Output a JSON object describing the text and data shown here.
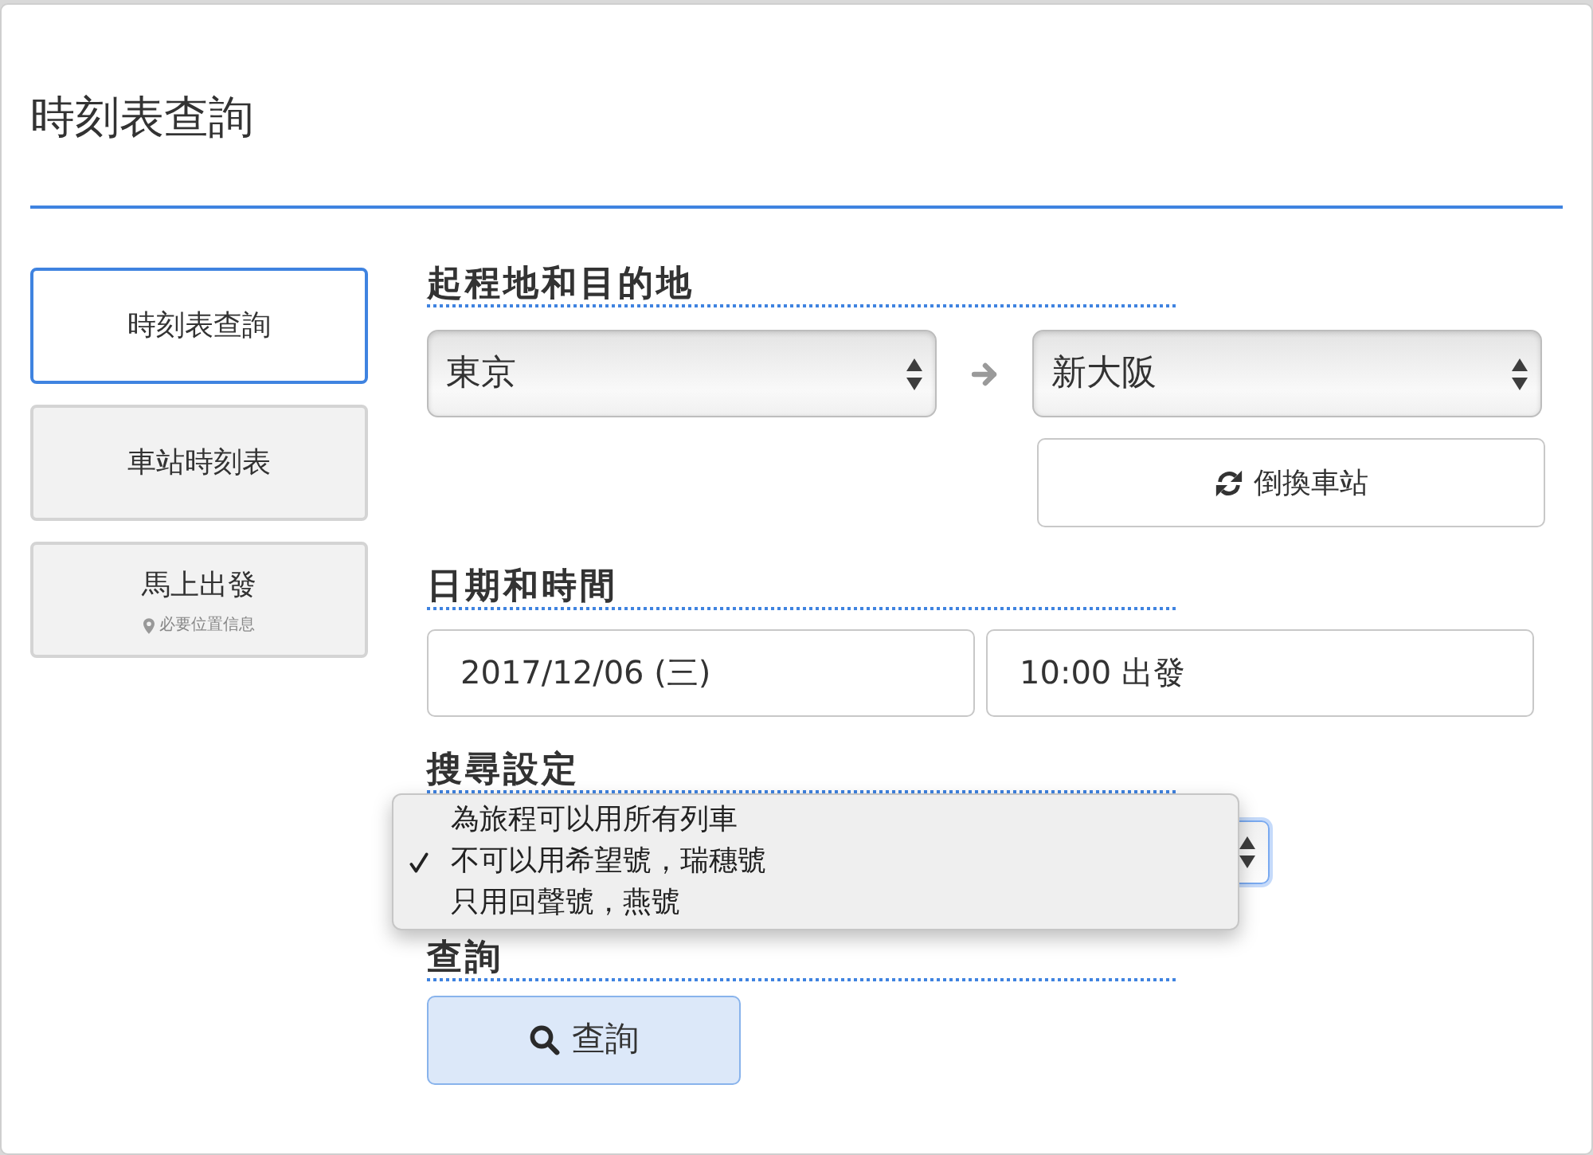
{
  "page_title": "時刻表查詢",
  "sidebar": {
    "items": [
      {
        "label": "時刻表查詢",
        "selected": true
      },
      {
        "label": "車站時刻表",
        "selected": false
      },
      {
        "label": "馬上出發",
        "selected": false,
        "note": "必要位置信息"
      }
    ]
  },
  "route": {
    "heading": "起程地和目的地",
    "from": "東京",
    "to": "新大阪",
    "swap_button": "倒換車站"
  },
  "date_time": {
    "heading": "日期和時間",
    "date": "2017/12/06 (三)",
    "time": "10:00 出發"
  },
  "search_settings": {
    "heading": "搜尋設定",
    "dropdown_open": true,
    "options": [
      {
        "label": "為旅程可以用所有列車",
        "selected": false
      },
      {
        "label": "不可以用希望號，瑞穗號",
        "selected": true
      },
      {
        "label": "只用回聲號，燕號",
        "selected": false
      }
    ]
  },
  "submit": {
    "heading": "查詢",
    "button": "查詢"
  }
}
